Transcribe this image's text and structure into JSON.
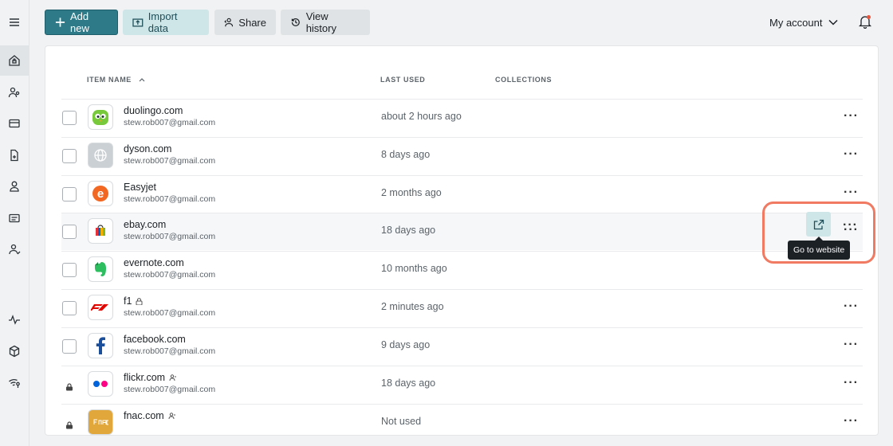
{
  "toolbar": {
    "add_new": "Add new",
    "import_data": "Import data",
    "share": "Share",
    "view_history": "View history",
    "account": "My account"
  },
  "table": {
    "headers": {
      "item_name": "ITEM NAME",
      "last_used": "LAST USED",
      "collections": "COLLECTIONS"
    },
    "rows": [
      {
        "name": "duolingo.com",
        "email": "stew.rob007@gmail.com",
        "last_used": "about 2 hours ago",
        "icon": "duolingo-logo"
      },
      {
        "name": "dyson.com",
        "email": "stew.rob007@gmail.com",
        "last_used": "8 days ago",
        "icon": "globe-icon"
      },
      {
        "name": "Easyjet",
        "email": "stew.rob007@gmail.com",
        "last_used": "2 months ago",
        "icon": "easyjet-logo"
      },
      {
        "name": "ebay.com",
        "email": "stew.rob007@gmail.com",
        "last_used": "18 days ago",
        "icon": "ebay-logo"
      },
      {
        "name": "evernote.com",
        "email": "stew.rob007@gmail.com",
        "last_used": "10 months ago",
        "icon": "evernote-logo"
      },
      {
        "name": "f1",
        "email": "stew.rob007@gmail.com",
        "last_used": "2 minutes ago",
        "icon": "f1-logo"
      },
      {
        "name": "facebook.com",
        "email": "stew.rob007@gmail.com",
        "last_used": "9 days ago",
        "icon": "facebook-logo"
      },
      {
        "name": "flickr.com",
        "email": "stew.rob007@gmail.com",
        "last_used": "18 days ago",
        "icon": "flickr-logo"
      },
      {
        "name": "fnac.com",
        "email": "",
        "last_used": "Not used",
        "icon": "fnac-logo"
      }
    ]
  },
  "tooltip": "Go to website",
  "colors": {
    "primary": "#2e7a89",
    "teal_light": "#cfe6e8",
    "highlight": "#f07a62"
  }
}
